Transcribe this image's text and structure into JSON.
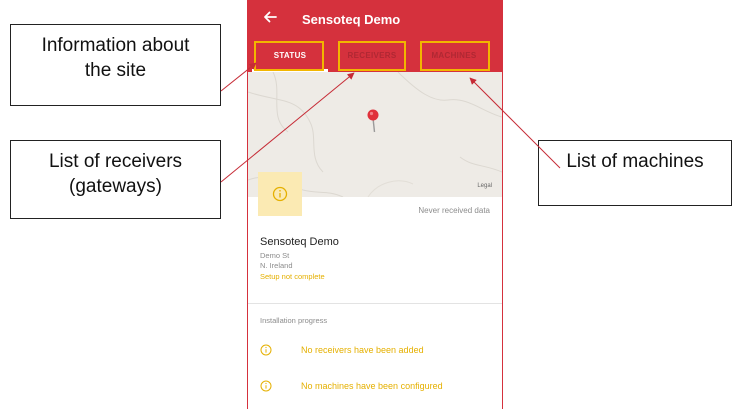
{
  "app": {
    "title": "Sensoteq Demo",
    "accent_color": "#d5313d",
    "highlight_color": "#f2b600"
  },
  "tabs": [
    {
      "label": "STATUS",
      "active": true
    },
    {
      "label": "RECEIVERS",
      "active": false
    },
    {
      "label": "MACHINES",
      "active": false
    }
  ],
  "map": {
    "legal_label": "Legal",
    "pin_icon": "map-pin-icon"
  },
  "site": {
    "status_icon": "info-icon",
    "data_status": "Never received data",
    "name": "Sensoteq Demo",
    "address_line1": "Demo St",
    "address_line2": "N. Ireland",
    "setup_status": "Setup not complete"
  },
  "progress": {
    "heading": "Installation progress",
    "items": [
      {
        "icon": "info-icon",
        "text": "No receivers have been added"
      },
      {
        "icon": "info-icon",
        "text": "No machines have been configured"
      }
    ]
  },
  "callouts": {
    "site_info": "Information about\nthe site",
    "receivers": "List of receivers\n(gateways)",
    "machines": "List of machines"
  }
}
